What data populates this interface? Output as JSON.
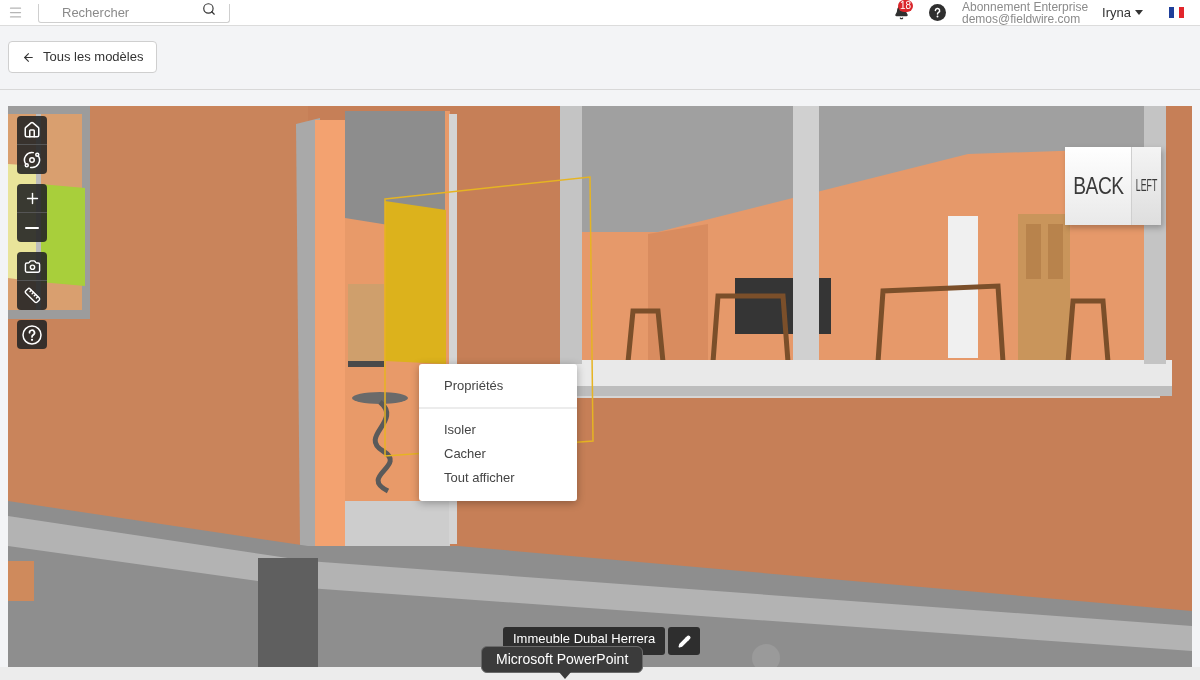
{
  "header": {
    "search": {
      "placeholder": "Rechercher"
    },
    "notifications": {
      "count": "18"
    },
    "account": {
      "plan": "Abonnement Enterprise",
      "email": "demos@fieldwire.com"
    },
    "user": {
      "name": "Iryna"
    }
  },
  "back_button": {
    "label": "Tous les modèles"
  },
  "viewer": {
    "nav_cube": {
      "face": "BACK",
      "side": "LEFT"
    },
    "context_menu": {
      "sections": [
        {
          "items": [
            {
              "label": "Propriétés"
            }
          ]
        },
        {
          "items": [
            {
              "label": "Isoler"
            },
            {
              "label": "Cacher"
            },
            {
              "label": "Tout afficher"
            }
          ]
        }
      ]
    },
    "model_name": "Immeuble Dubal Herrera"
  },
  "tooltip": {
    "text": "Microsoft PowerPoint"
  }
}
